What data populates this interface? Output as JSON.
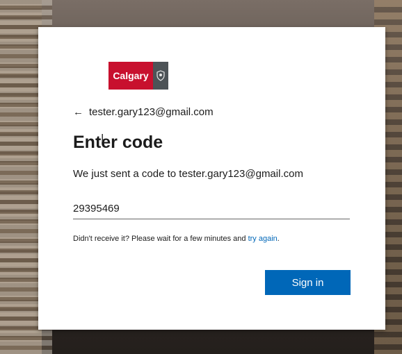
{
  "logo": {
    "text": "Calgary"
  },
  "identity": {
    "back_icon": "←",
    "email": "tester.gary123@gmail.com"
  },
  "form": {
    "title": "Enter code",
    "description": "We just sent a code to tester.gary123@gmail.com",
    "code_value": "29395469",
    "help_text": "Didn't receive it? Please wait for a few minutes and ",
    "help_link": "try again",
    "help_suffix": ".",
    "signin_label": "Sign in"
  },
  "colors": {
    "brand_red": "#c8102e",
    "accent_blue": "#0067b8"
  }
}
